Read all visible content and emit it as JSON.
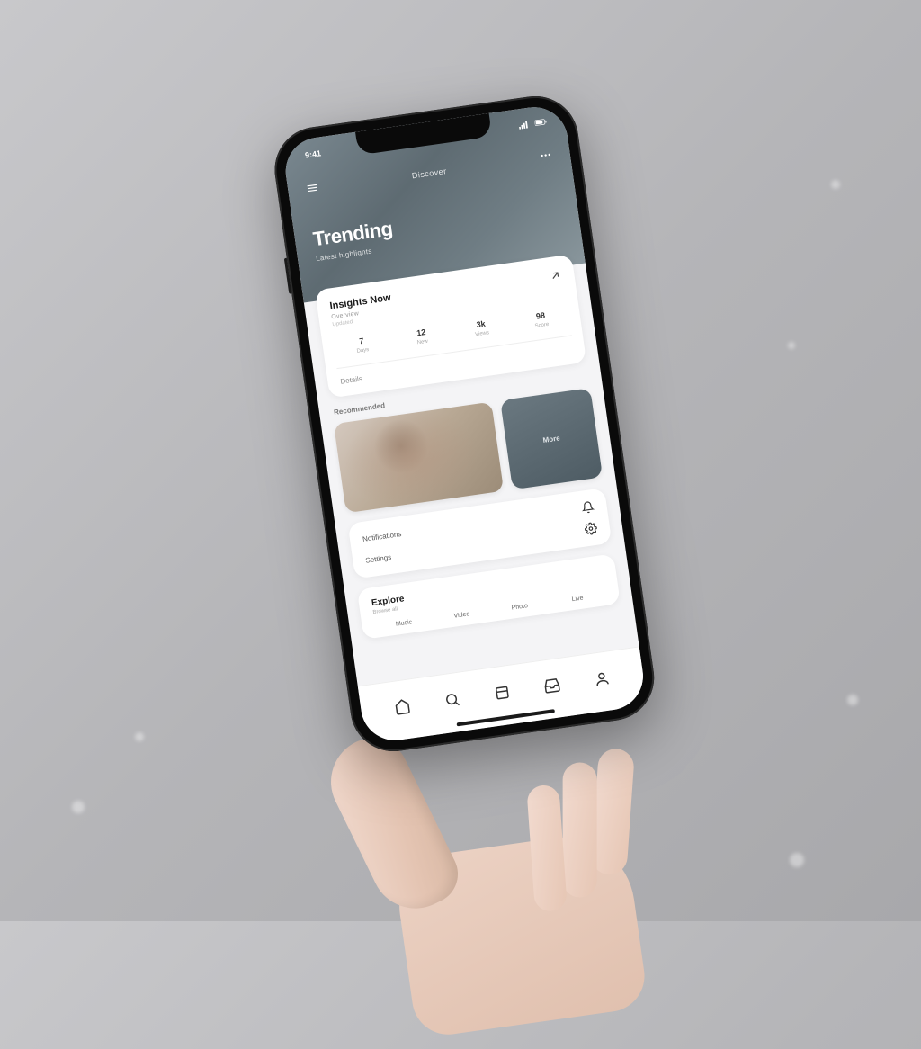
{
  "statusbar": {
    "time": "9:41"
  },
  "hero": {
    "top_label": "Discover",
    "title": "Trending",
    "subtitle": "Latest highlights"
  },
  "summary": {
    "title": "Insights Now",
    "sub1": "Overview",
    "sub2": "Updated",
    "stats": [
      {
        "value": "7",
        "label": "Days"
      },
      {
        "value": "12",
        "label": "New"
      },
      {
        "value": "3k",
        "label": "Views"
      },
      {
        "value": "98",
        "label": "Score"
      }
    ],
    "footer_label": "Details"
  },
  "media": {
    "section_label": "Recommended",
    "side_label": "More"
  },
  "actions": {
    "items": [
      {
        "label": "Notifications"
      },
      {
        "label": "Settings"
      }
    ]
  },
  "bottom": {
    "title": "Explore",
    "sub": "Browse all",
    "cols": [
      "Music",
      "Video",
      "Photo",
      "Live"
    ]
  },
  "tabs": [
    "Home",
    "Search",
    "Library",
    "Inbox",
    "Profile"
  ]
}
